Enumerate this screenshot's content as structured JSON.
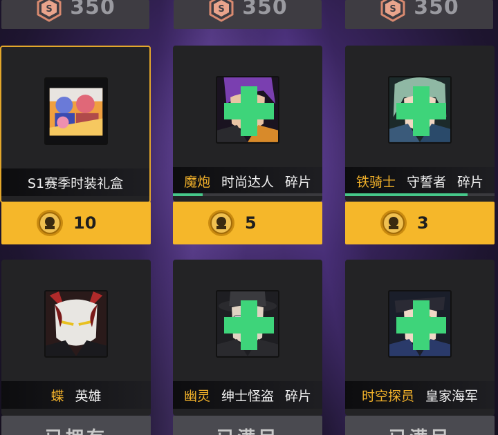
{
  "top_row": [
    {
      "price": "350"
    },
    {
      "price": "350"
    },
    {
      "price": "350"
    }
  ],
  "cards": [
    {
      "name_highlight": "",
      "name": "S1赛季时装礼盒",
      "type": "",
      "selected": true,
      "shard": false,
      "progress": null
    },
    {
      "name_highlight": "魔炮",
      "name": "时尚达人",
      "type": "碎片",
      "selected": false,
      "shard": true,
      "progress": 0.2
    },
    {
      "name_highlight": "铁骑士",
      "name": "守誓者",
      "type": "碎片",
      "selected": false,
      "shard": true,
      "progress": 0.82
    },
    {
      "name_highlight": "蝶",
      "name": "英雄",
      "type": "",
      "selected": false,
      "shard": false,
      "progress": null
    },
    {
      "name_highlight": "幽灵",
      "name": "绅士怪盗",
      "type": "碎片",
      "selected": false,
      "shard": true,
      "progress": null
    },
    {
      "name_highlight": "时空探员",
      "name": "皇家海军",
      "type": "",
      "selected": false,
      "shard": true,
      "progress": null
    }
  ],
  "prices": [
    {
      "amount": "10"
    },
    {
      "amount": "5"
    },
    {
      "amount": "3"
    }
  ],
  "bottom_row": [
    {
      "label": "已拥有"
    },
    {
      "label": "已满足"
    },
    {
      "label": "已满足"
    }
  ],
  "colors": {
    "accent_gold": "#f5b72a",
    "highlight_text": "#f2b12a",
    "progress_green": "#46c88a",
    "card_bg": "#232325"
  },
  "icons": {
    "currency": "hex-currency-icon",
    "coin": "gold-coin-icon",
    "shard": "green-cross-shard-icon"
  }
}
